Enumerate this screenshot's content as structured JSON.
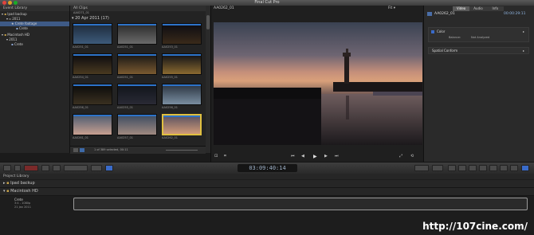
{
  "app": {
    "title": "Final Cut Pro"
  },
  "event_library": {
    "header": "Event Library",
    "items": [
      {
        "label": "Ipad backup"
      },
      {
        "label": "2011"
      },
      {
        "label": "Crete footage"
      },
      {
        "label": "Crete"
      },
      {
        "label": "Macintosh HD"
      },
      {
        "label": "2011"
      },
      {
        "label": "Crete"
      }
    ]
  },
  "browser": {
    "header": "All Clips",
    "breadcrumb": "AA0271_01",
    "group_label": "20 Apr 2011  (17)",
    "status": "1 of 389 selected, 00:11",
    "clips": [
      "AA0251_01",
      "AA0251_01",
      "AA0253_01",
      "AA0254_01",
      "AA0251_01",
      "AA0255_01",
      "AA0256_01",
      "AA0255_01",
      "AA0256_01",
      "AA0261_01",
      "AA0257_01",
      "AA0262_01"
    ]
  },
  "viewer": {
    "clip_name": "AA0262_01",
    "zoom": "Fit"
  },
  "inspector": {
    "tabs": [
      "Video",
      "Audio",
      "Info"
    ],
    "clip_name": "AA0262_01",
    "timecode": "00:00:29:11",
    "color_label": "Color",
    "balance_label": "Balance:",
    "balance_value": "Not Analyzed",
    "spatial_label": "Spatial Conform"
  },
  "toolbar": {
    "timecode": "03:09:40:14"
  },
  "project_library": {
    "header": "Project Library",
    "rows": [
      "Ipad backup",
      "Macintosh HD"
    ],
    "project": {
      "name": "Crete",
      "meta": "21 Jan 2011",
      "format": "3:4 - 1080p"
    }
  },
  "watermark": "http://107cine.com/"
}
